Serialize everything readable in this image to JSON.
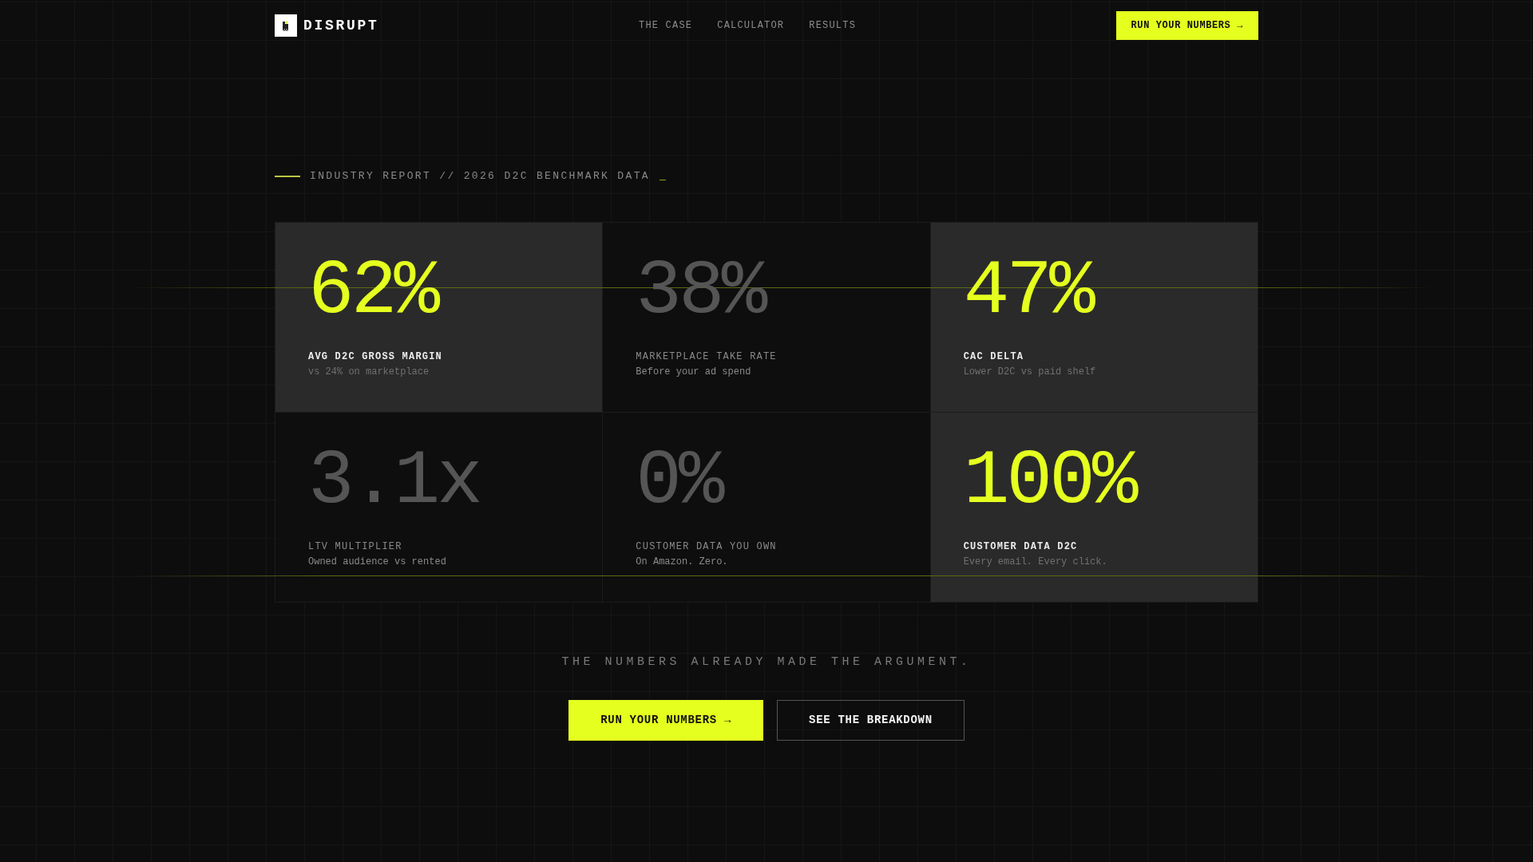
{
  "header": {
    "brand": "DISRUPT",
    "nav": [
      {
        "label": "THE CASE"
      },
      {
        "label": "CALCULATOR"
      },
      {
        "label": "RESULTS"
      }
    ],
    "cta": "RUN YOUR NUMBERS →"
  },
  "eyebrow": {
    "text": "INDUSTRY REPORT // 2026 D2C BENCHMARK DATA",
    "cursor": "_"
  },
  "stats": [
    {
      "value": "62%",
      "label": "AVG D2C GROSS MARGIN",
      "note": "vs 24% on marketplace",
      "highlighted": true
    },
    {
      "value": "38%",
      "label": "MARKETPLACE TAKE RATE",
      "note": "Before your ad spend",
      "highlighted": false
    },
    {
      "value": "47%",
      "label": "CAC DELTA",
      "note": "Lower D2C vs paid shelf",
      "highlighted": true
    },
    {
      "value": "3.1x",
      "label": "LTV MULTIPLIER",
      "note": "Owned audience vs rented",
      "highlighted": false
    },
    {
      "value": "0%",
      "label": "CUSTOMER DATA YOU OWN",
      "note": "On Amazon. Zero.",
      "highlighted": false
    },
    {
      "value": "100%",
      "label": "CUSTOMER DATA D2C",
      "note": "Every email. Every click.",
      "highlighted": true
    }
  ],
  "tagline": "THE NUMBERS ALREADY MADE THE ARGUMENT.",
  "actions": [
    {
      "label": "RUN YOUR NUMBERS →",
      "kind": "primary"
    },
    {
      "label": "SEE THE BREAKDOWN",
      "kind": "outline"
    }
  ]
}
